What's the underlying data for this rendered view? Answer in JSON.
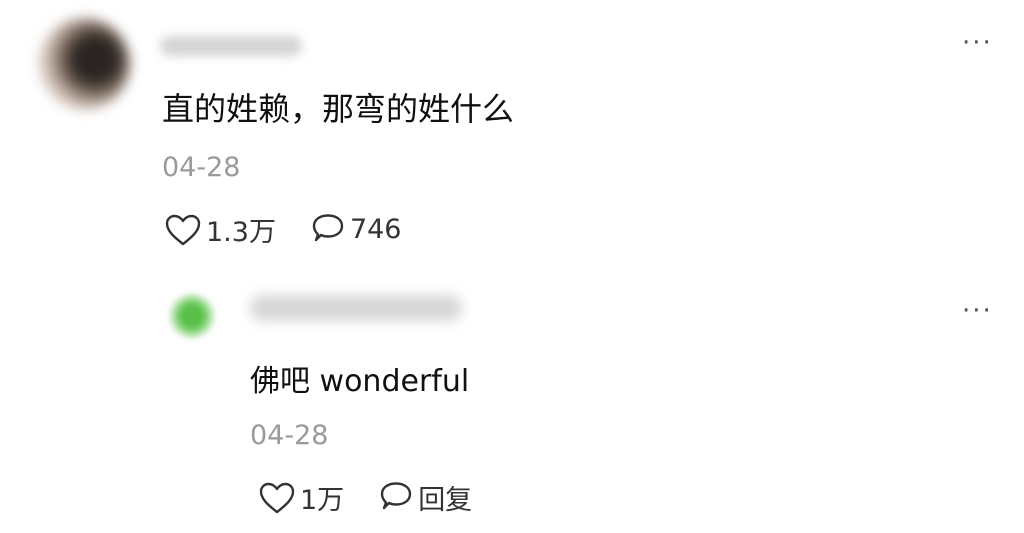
{
  "comment": {
    "text": "直的姓赖，那弯的姓什么",
    "date": "04-28",
    "likes": "1.3万",
    "replies": "746",
    "more_icon": "more-icon"
  },
  "reply": {
    "text": "佛吧 wonderful",
    "date": "04-28",
    "likes": "1万",
    "reply_label": "回复",
    "more_icon": "more-icon"
  },
  "colors": {
    "text": "#111111",
    "meta": "#9a9a9a",
    "icon": "#333333"
  }
}
